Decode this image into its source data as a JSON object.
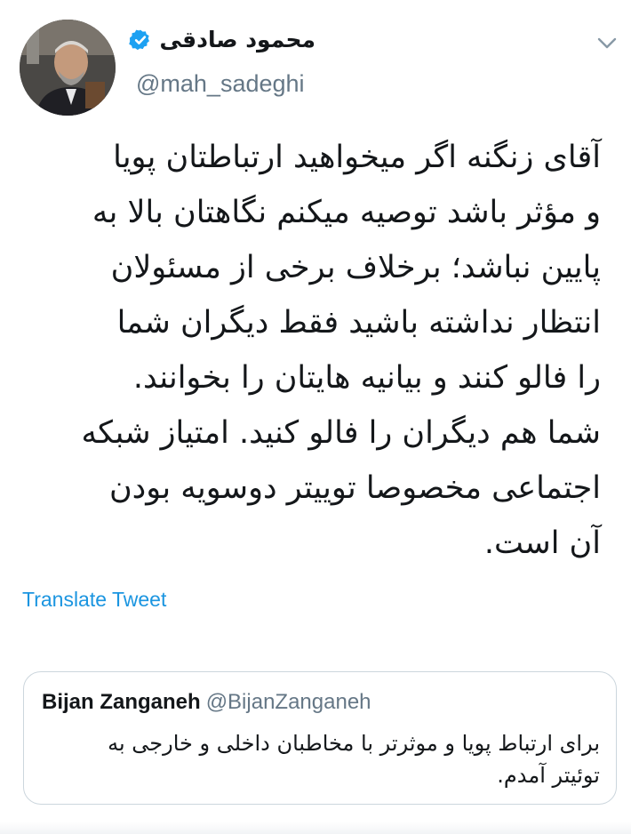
{
  "tweet": {
    "author_name": "محمود صادقی",
    "handle": "@mah_sadeghi",
    "verified": true,
    "body_lines": [
      "آقای زنگنه اگر میخواهید ارتباطتان پویا",
      "و مؤثر باشد توصیه میکنم نگاهتان بالا به",
      "پایین نباشد؛ برخلاف برخی از مسئولان",
      "انتظار نداشته باشید فقط دیگران شما",
      "را فالو کنند و بیانیه هایتان را بخوانند.",
      "شما هم دیگران را فالو کنید. امتیاز شبکه",
      "اجتماعی مخصوصا توییتر دوسویه بودن",
      "آن است."
    ],
    "translate_label": "Translate Tweet"
  },
  "quoted_tweet": {
    "name": "Bijan Zanganeh",
    "handle": "@BijanZanganeh",
    "body_lines": [
      "برای ارتباط پویا و موثرتر با مخاطبان داخلی و خارجی به",
      "توئیتر آمدم."
    ]
  },
  "icons": {
    "verified": "verified-badge-icon",
    "menu": "chevron-down-icon",
    "avatar": "profile-photo"
  },
  "colors": {
    "link": "#1b95e0",
    "verified": "#1da1f2",
    "secondary_text": "#657786",
    "border": "#ccd6dd"
  }
}
